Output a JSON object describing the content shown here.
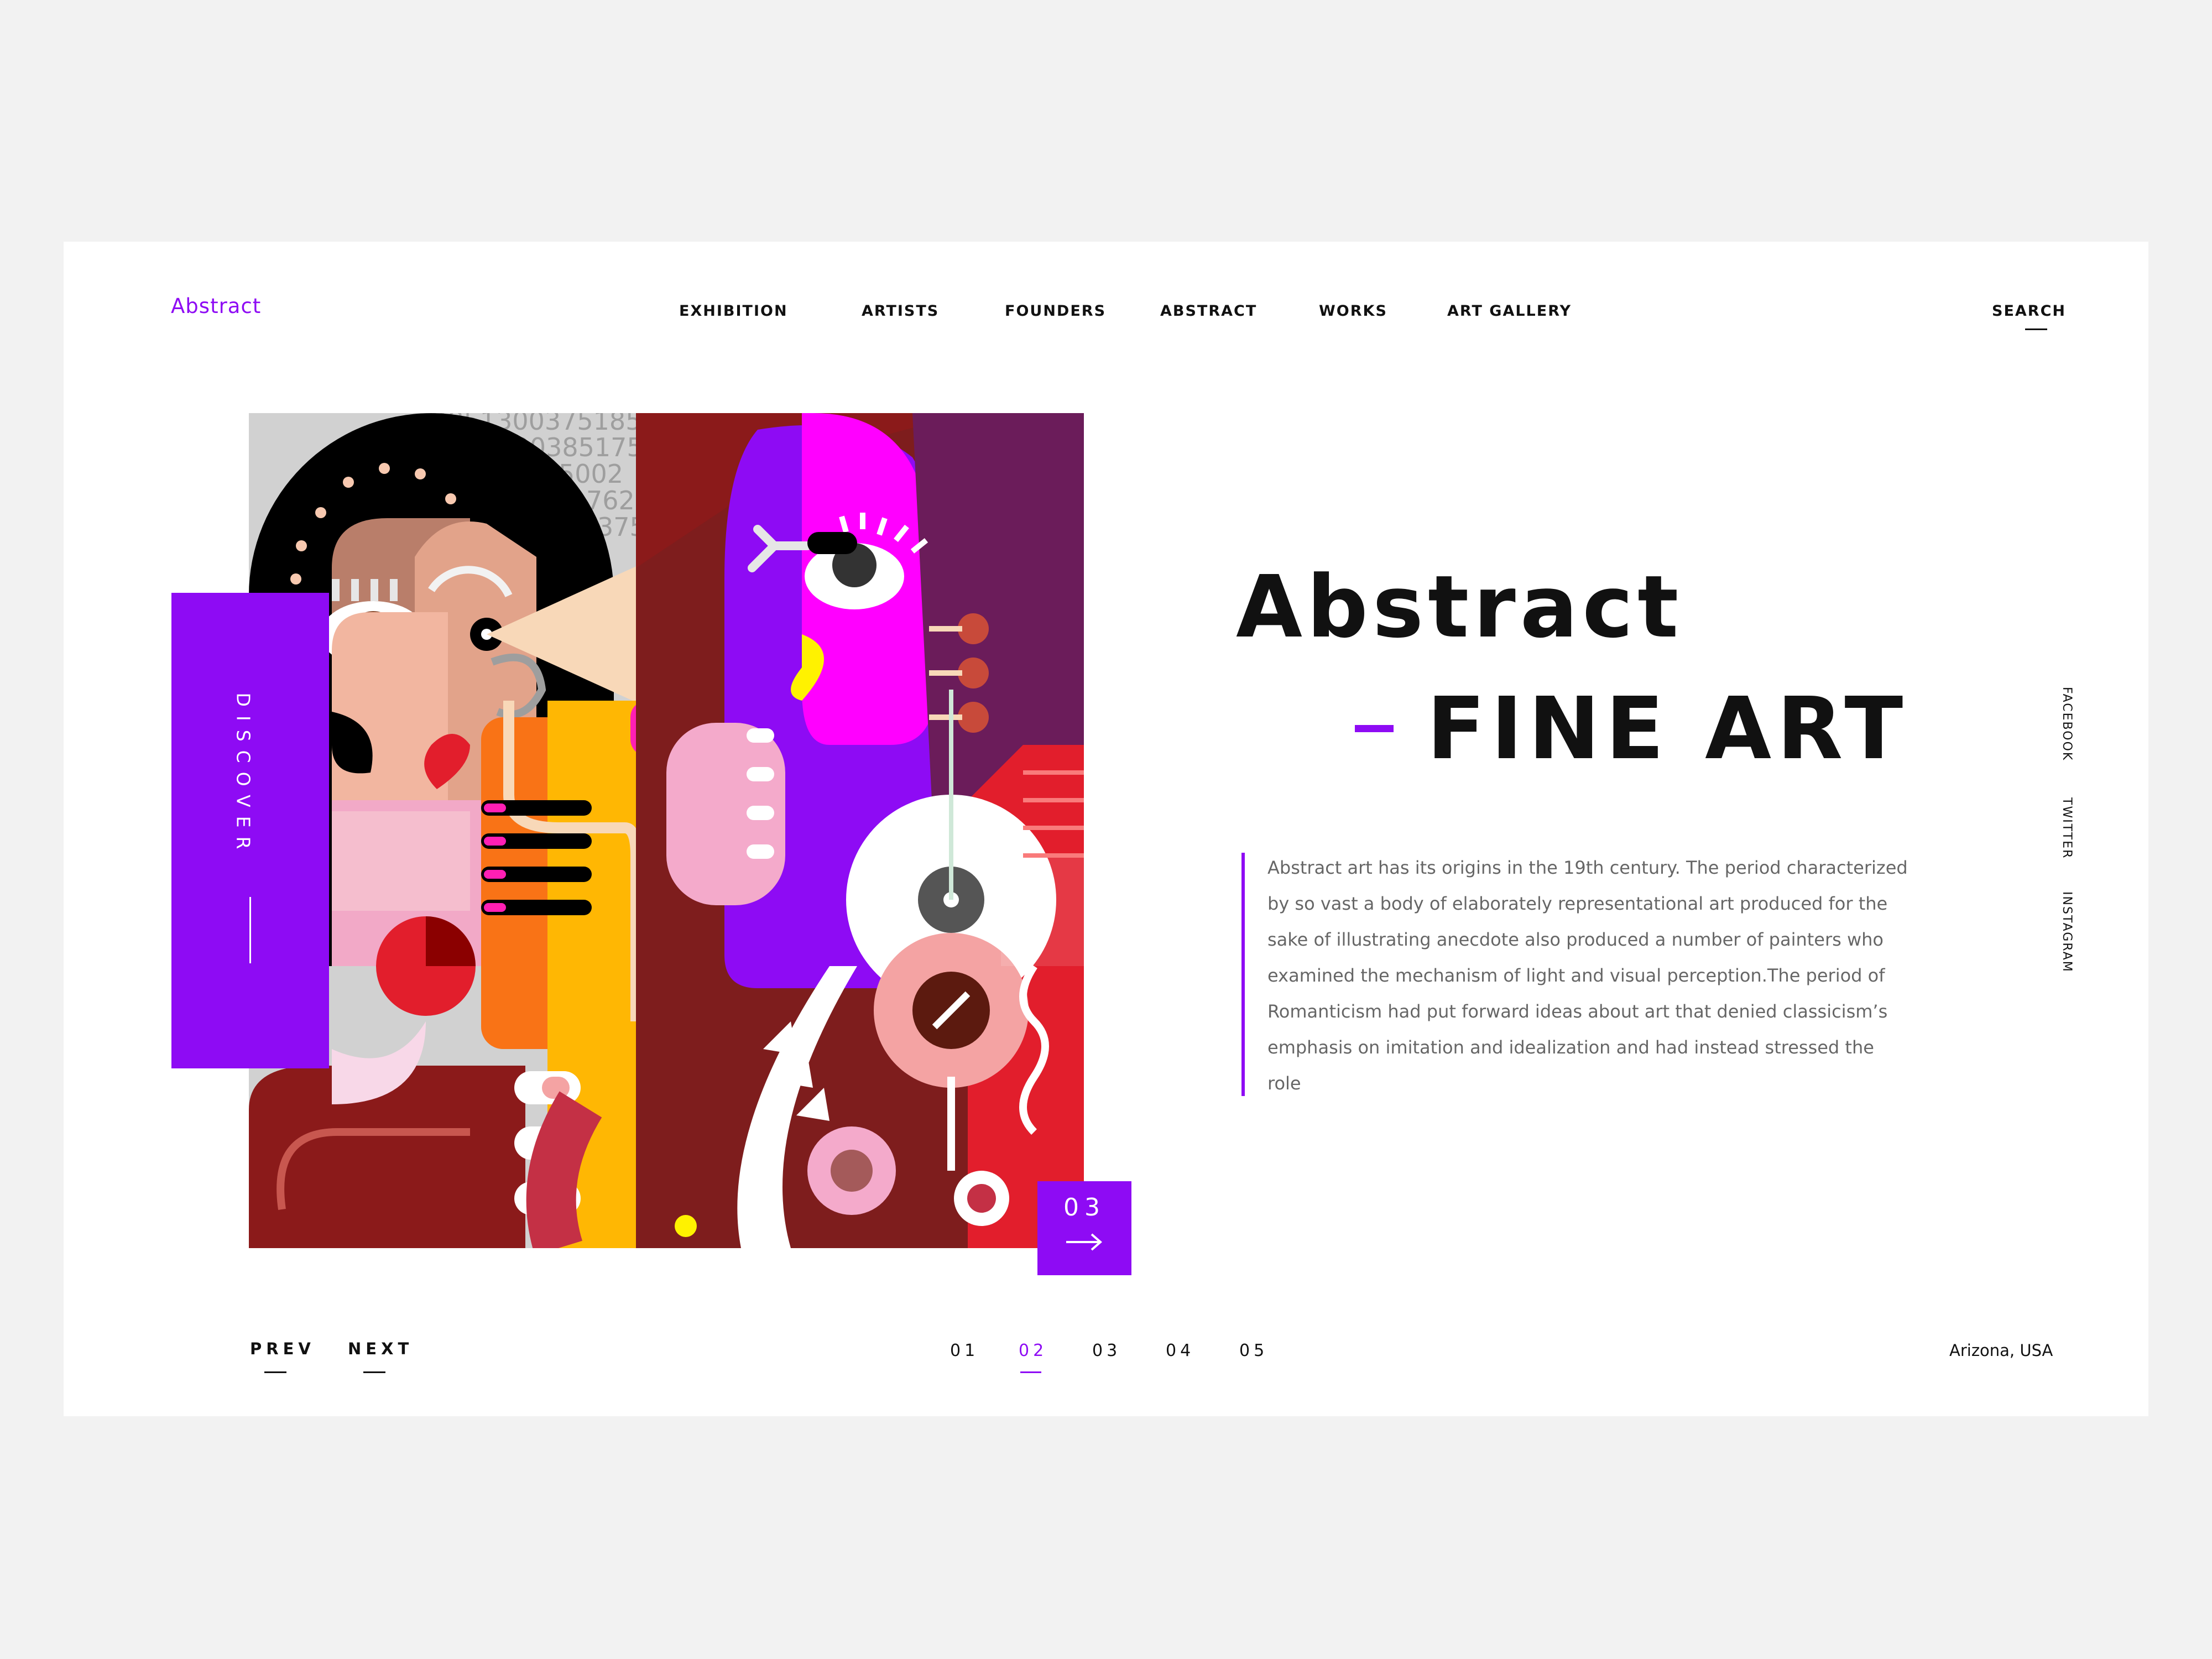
{
  "brand": {
    "logo": "Abstract",
    "accent_color": "#8e0bf4"
  },
  "nav": {
    "items": [
      {
        "label": "EXHIBITION"
      },
      {
        "label": "ARTISTS"
      },
      {
        "label": "FOUNDERS"
      },
      {
        "label": "ABSTRACT"
      },
      {
        "label": "WORKS"
      },
      {
        "label": "ART GALLERY"
      }
    ],
    "search_label": "SEARCH"
  },
  "hero": {
    "discover_label": "DISCOVER",
    "slide_number": "03",
    "artwork_digits": [
      "2851300375185002",
      "7620385175",
      "5002",
      "762",
      "375"
    ],
    "title_line1": "Abstract",
    "title_line2": "FINE ART",
    "description": "Abstract art has its origins in the 19th century. The period characterized by so vast a body of elaborately representational art produced for the sake of illustrating anecdote also produced a number of painters who examined the mechanism of light and visual perception.The period of Romanticism had put forward ideas about art that denied classicism’s emphasis on imitation and idealization and had instead stressed the role"
  },
  "social": {
    "facebook": "FACEBOOK",
    "twitter": "TWITTER",
    "instagram": "INSTAGRAM"
  },
  "footer": {
    "prev_label": "PREV",
    "next_label": "NEXT",
    "pages": [
      "01",
      "02",
      "03",
      "04",
      "05"
    ],
    "active_page": "02",
    "location": "Arizona, USA"
  }
}
